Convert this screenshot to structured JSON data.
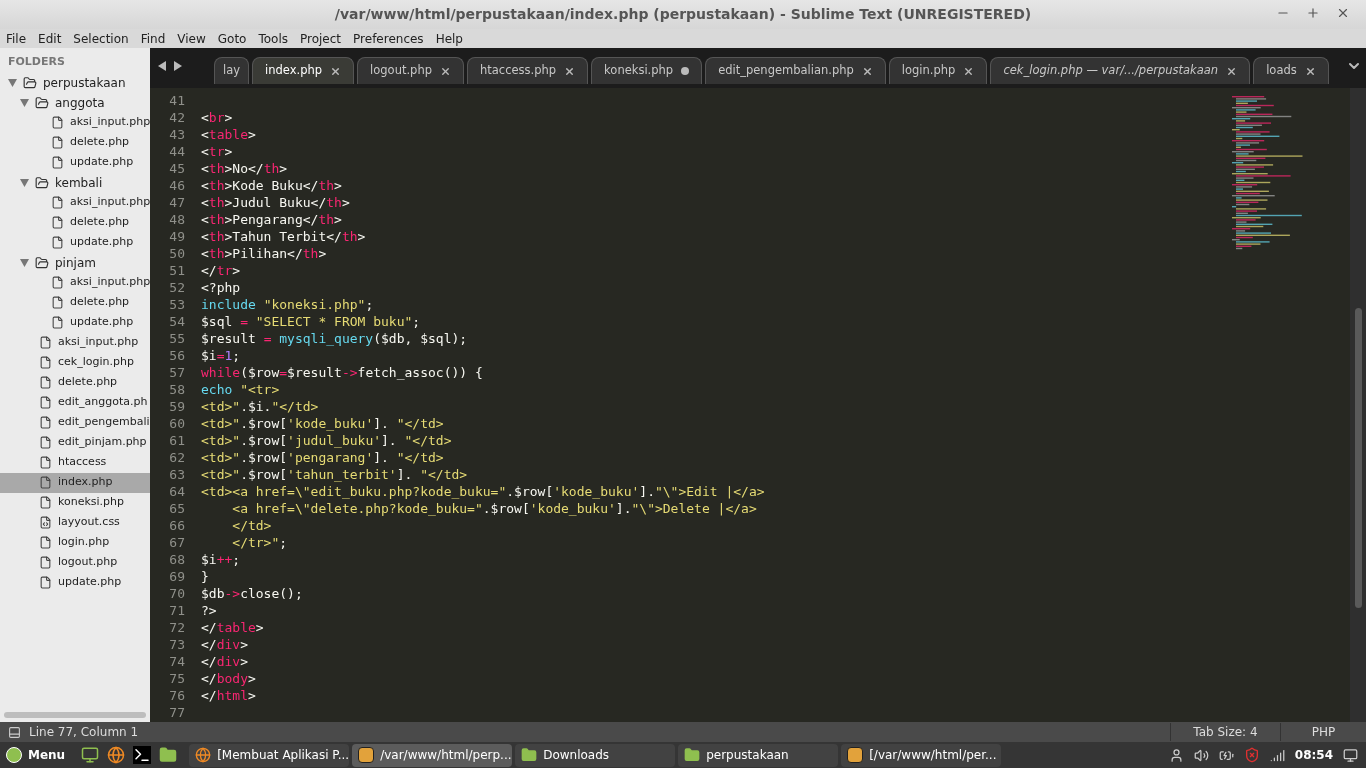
{
  "window": {
    "title": "/var/www/html/perpustakaan/index.php (perpustakaan) - Sublime Text (UNREGISTERED)"
  },
  "menu": [
    "File",
    "Edit",
    "Selection",
    "Find",
    "View",
    "Goto",
    "Tools",
    "Project",
    "Preferences",
    "Help"
  ],
  "sidebar": {
    "heading": "FOLDERS",
    "items": [
      {
        "kind": "folder",
        "label": "perpustakaan",
        "expanded": true,
        "selected": false,
        "children": [
          {
            "kind": "folder",
            "label": "anggota",
            "expanded": true,
            "selected": false,
            "children": [
              {
                "kind": "file",
                "label": "aksi_input.php",
                "selected": false
              },
              {
                "kind": "file",
                "label": "delete.php",
                "selected": false
              },
              {
                "kind": "file",
                "label": "update.php",
                "selected": false
              }
            ]
          },
          {
            "kind": "folder",
            "label": "kembali",
            "expanded": true,
            "selected": false,
            "children": [
              {
                "kind": "file",
                "label": "aksi_input.php",
                "selected": false
              },
              {
                "kind": "file",
                "label": "delete.php",
                "selected": false
              },
              {
                "kind": "file",
                "label": "update.php",
                "selected": false
              }
            ]
          },
          {
            "kind": "folder",
            "label": "pinjam",
            "expanded": true,
            "selected": false,
            "children": [
              {
                "kind": "file",
                "label": "aksi_input.php",
                "selected": false
              },
              {
                "kind": "file",
                "label": "delete.php",
                "selected": false
              },
              {
                "kind": "file",
                "label": "update.php",
                "selected": false
              }
            ]
          },
          {
            "kind": "file",
            "label": "aksi_input.php",
            "selected": false
          },
          {
            "kind": "file",
            "label": "cek_login.php",
            "selected": false
          },
          {
            "kind": "file",
            "label": "delete.php",
            "selected": false
          },
          {
            "kind": "file",
            "label": "edit_anggota.ph",
            "selected": false
          },
          {
            "kind": "file",
            "label": "edit_pengembali",
            "selected": false
          },
          {
            "kind": "file",
            "label": "edit_pinjam.php",
            "selected": false
          },
          {
            "kind": "file",
            "label": "htaccess",
            "selected": false
          },
          {
            "kind": "file",
            "label": "index.php",
            "selected": true
          },
          {
            "kind": "file",
            "label": "koneksi.php",
            "selected": false
          },
          {
            "kind": "style",
            "label": "layyout.css",
            "selected": false
          },
          {
            "kind": "file",
            "label": "login.php",
            "selected": false
          },
          {
            "kind": "file",
            "label": "logout.php",
            "selected": false
          },
          {
            "kind": "file",
            "label": "update.php",
            "selected": false
          }
        ]
      }
    ]
  },
  "tabs": [
    {
      "label": "lay",
      "selected": false,
      "dirty": false,
      "transient": false,
      "cut": true
    },
    {
      "label": "index.php",
      "selected": true,
      "dirty": false,
      "transient": false,
      "cut": false
    },
    {
      "label": "logout.php",
      "selected": false,
      "dirty": false,
      "transient": false,
      "cut": false
    },
    {
      "label": "htaccess.php",
      "selected": false,
      "dirty": false,
      "transient": false,
      "cut": false
    },
    {
      "label": "koneksi.php",
      "selected": false,
      "dirty": true,
      "transient": false,
      "cut": false
    },
    {
      "label": "edit_pengembalian.php",
      "selected": false,
      "dirty": false,
      "transient": false,
      "cut": false
    },
    {
      "label": "login.php",
      "selected": false,
      "dirty": false,
      "transient": false,
      "cut": false
    },
    {
      "label": "cek_login.php — var/.../perpustakaan",
      "selected": false,
      "dirty": false,
      "transient": true,
      "cut": false
    },
    {
      "label": "loads",
      "selected": false,
      "dirty": false,
      "transient": false,
      "cut": false
    }
  ],
  "code": [
    {
      "n": "41"
    },
    {
      "n": "42",
      "tokens": [
        {
          "kind": "plain",
          "text": "<"
        },
        {
          "kind": "tag",
          "text": "br"
        },
        {
          "kind": "plain",
          "text": ">"
        }
      ]
    },
    {
      "n": "43",
      "tokens": [
        {
          "kind": "plain",
          "text": "<"
        },
        {
          "kind": "tag",
          "text": "table"
        },
        {
          "kind": "plain",
          "text": ">"
        }
      ]
    },
    {
      "n": "44",
      "tokens": [
        {
          "kind": "plain",
          "text": "<"
        },
        {
          "kind": "tag",
          "text": "tr"
        },
        {
          "kind": "plain",
          "text": ">"
        }
      ]
    },
    {
      "n": "45",
      "tokens": [
        {
          "kind": "plain",
          "text": "<"
        },
        {
          "kind": "tag",
          "text": "th"
        },
        {
          "kind": "plain",
          "text": ">No</"
        },
        {
          "kind": "tag",
          "text": "th"
        },
        {
          "kind": "plain",
          "text": ">"
        }
      ]
    },
    {
      "n": "46",
      "tokens": [
        {
          "kind": "plain",
          "text": "<"
        },
        {
          "kind": "tag",
          "text": "th"
        },
        {
          "kind": "plain",
          "text": ">Kode Buku</"
        },
        {
          "kind": "tag",
          "text": "th"
        },
        {
          "kind": "plain",
          "text": ">"
        }
      ]
    },
    {
      "n": "47",
      "tokens": [
        {
          "kind": "plain",
          "text": "<"
        },
        {
          "kind": "tag",
          "text": "th"
        },
        {
          "kind": "plain",
          "text": ">Judul Buku</"
        },
        {
          "kind": "tag",
          "text": "th"
        },
        {
          "kind": "plain",
          "text": ">"
        }
      ]
    },
    {
      "n": "48",
      "tokens": [
        {
          "kind": "plain",
          "text": "<"
        },
        {
          "kind": "tag",
          "text": "th"
        },
        {
          "kind": "plain",
          "text": ">Pengarang</"
        },
        {
          "kind": "tag",
          "text": "th"
        },
        {
          "kind": "plain",
          "text": ">"
        }
      ]
    },
    {
      "n": "49",
      "tokens": [
        {
          "kind": "plain",
          "text": "<"
        },
        {
          "kind": "tag",
          "text": "th"
        },
        {
          "kind": "plain",
          "text": ">Tahun Terbit</"
        },
        {
          "kind": "tag",
          "text": "th"
        },
        {
          "kind": "plain",
          "text": ">"
        }
      ]
    },
    {
      "n": "50",
      "tokens": [
        {
          "kind": "plain",
          "text": "<"
        },
        {
          "kind": "tag",
          "text": "th"
        },
        {
          "kind": "plain",
          "text": ">Pilihan</"
        },
        {
          "kind": "tag",
          "text": "th"
        },
        {
          "kind": "plain",
          "text": ">"
        }
      ]
    },
    {
      "n": "51",
      "tokens": [
        {
          "kind": "plain",
          "text": "</"
        },
        {
          "kind": "tag",
          "text": "tr"
        },
        {
          "kind": "plain",
          "text": ">"
        }
      ]
    },
    {
      "n": "52",
      "tokens": [
        {
          "kind": "plain",
          "text": "<?php"
        }
      ]
    },
    {
      "n": "53",
      "tokens": [
        {
          "kind": "func",
          "text": "include "
        },
        {
          "kind": "string",
          "text": "\"koneksi.php\""
        },
        {
          "kind": "plain",
          "text": ";"
        }
      ]
    },
    {
      "n": "54",
      "tokens": [
        {
          "kind": "plain",
          "text": "$sql "
        },
        {
          "kind": "tag",
          "text": "= "
        },
        {
          "kind": "string",
          "text": "\"SELECT * FROM buku\""
        },
        {
          "kind": "plain",
          "text": ";"
        }
      ]
    },
    {
      "n": "55",
      "tokens": [
        {
          "kind": "plain",
          "text": "$result "
        },
        {
          "kind": "tag",
          "text": "= "
        },
        {
          "kind": "func",
          "text": "mysqli_query"
        },
        {
          "kind": "plain",
          "text": "($db, $sql);"
        }
      ]
    },
    {
      "n": "56",
      "tokens": [
        {
          "kind": "plain",
          "text": "$i"
        },
        {
          "kind": "tag",
          "text": "="
        },
        {
          "kind": "number",
          "text": "1"
        },
        {
          "kind": "plain",
          "text": ";"
        }
      ]
    },
    {
      "n": "57",
      "tokens": [
        {
          "kind": "tag",
          "text": "while"
        },
        {
          "kind": "plain",
          "text": "($row"
        },
        {
          "kind": "tag",
          "text": "="
        },
        {
          "kind": "plain",
          "text": "$result"
        },
        {
          "kind": "tag",
          "text": "->"
        },
        {
          "kind": "plain",
          "text": "fetch_assoc()) {"
        }
      ]
    },
    {
      "n": "58",
      "tokens": [
        {
          "kind": "func",
          "text": "echo "
        },
        {
          "kind": "string",
          "text": "\"<tr>"
        }
      ]
    },
    {
      "n": "59",
      "tokens": [
        {
          "kind": "string",
          "text": "<td>\""
        },
        {
          "kind": "plain",
          "text": ".$i."
        },
        {
          "kind": "string",
          "text": "\"</td>"
        }
      ]
    },
    {
      "n": "60",
      "tokens": [
        {
          "kind": "string",
          "text": "<td>\""
        },
        {
          "kind": "plain",
          "text": ".$row["
        },
        {
          "kind": "string",
          "text": "'kode_buku'"
        },
        {
          "kind": "plain",
          "text": "]. "
        },
        {
          "kind": "string",
          "text": "\"</td>"
        }
      ]
    },
    {
      "n": "61",
      "tokens": [
        {
          "kind": "string",
          "text": "<td>\""
        },
        {
          "kind": "plain",
          "text": ".$row["
        },
        {
          "kind": "string",
          "text": "'judul_buku'"
        },
        {
          "kind": "plain",
          "text": "]. "
        },
        {
          "kind": "string",
          "text": "\"</td>"
        }
      ]
    },
    {
      "n": "62",
      "tokens": [
        {
          "kind": "string",
          "text": "<td>\""
        },
        {
          "kind": "plain",
          "text": ".$row["
        },
        {
          "kind": "string",
          "text": "'pengarang'"
        },
        {
          "kind": "plain",
          "text": "]. "
        },
        {
          "kind": "string",
          "text": "\"</td>"
        }
      ]
    },
    {
      "n": "63",
      "tokens": [
        {
          "kind": "string",
          "text": "<td>\""
        },
        {
          "kind": "plain",
          "text": ".$row["
        },
        {
          "kind": "string",
          "text": "'tahun_terbit'"
        },
        {
          "kind": "plain",
          "text": "]. "
        },
        {
          "kind": "string",
          "text": "\"</td>"
        }
      ]
    },
    {
      "n": "64",
      "tokens": [
        {
          "kind": "string",
          "text": "<td><a href=\\\"edit_buku.php?kode_buku=\""
        },
        {
          "kind": "plain",
          "text": ".$row["
        },
        {
          "kind": "string",
          "text": "'kode_buku'"
        },
        {
          "kind": "plain",
          "text": "]."
        },
        {
          "kind": "string",
          "text": "\"\\\">Edit |</a>"
        }
      ]
    },
    {
      "n": "65",
      "tokens": [
        {
          "kind": "string",
          "text": "    <a href=\\\"delete.php?kode_buku=\""
        },
        {
          "kind": "plain",
          "text": ".$row["
        },
        {
          "kind": "string",
          "text": "'kode_buku'"
        },
        {
          "kind": "plain",
          "text": "]."
        },
        {
          "kind": "string",
          "text": "\"\\\">Delete |</a>"
        }
      ]
    },
    {
      "n": "66",
      "tokens": [
        {
          "kind": "string",
          "text": "    </td>"
        }
      ]
    },
    {
      "n": "67",
      "tokens": [
        {
          "kind": "string",
          "text": "    </tr>\""
        },
        {
          "kind": "plain",
          "text": ";"
        }
      ]
    },
    {
      "n": "68",
      "tokens": [
        {
          "kind": "plain",
          "text": "$i"
        },
        {
          "kind": "tag",
          "text": "++"
        },
        {
          "kind": "plain",
          "text": ";"
        }
      ]
    },
    {
      "n": "69",
      "tokens": [
        {
          "kind": "plain",
          "text": "}"
        }
      ]
    },
    {
      "n": "70",
      "tokens": [
        {
          "kind": "plain",
          "text": "$db"
        },
        {
          "kind": "tag",
          "text": "->"
        },
        {
          "kind": "plain",
          "text": "close();"
        }
      ]
    },
    {
      "n": "71",
      "tokens": [
        {
          "kind": "plain",
          "text": "?>"
        }
      ]
    },
    {
      "n": "72",
      "tokens": [
        {
          "kind": "plain",
          "text": "</"
        },
        {
          "kind": "tag",
          "text": "table"
        },
        {
          "kind": "plain",
          "text": ">"
        }
      ]
    },
    {
      "n": "73",
      "tokens": [
        {
          "kind": "plain",
          "text": "</"
        },
        {
          "kind": "tag",
          "text": "div"
        },
        {
          "kind": "plain",
          "text": ">"
        }
      ]
    },
    {
      "n": "74",
      "tokens": [
        {
          "kind": "plain",
          "text": "</"
        },
        {
          "kind": "tag",
          "text": "div"
        },
        {
          "kind": "plain",
          "text": ">"
        }
      ]
    },
    {
      "n": "75",
      "tokens": [
        {
          "kind": "plain",
          "text": "</"
        },
        {
          "kind": "tag",
          "text": "body"
        },
        {
          "kind": "plain",
          "text": ">"
        }
      ]
    },
    {
      "n": "76",
      "tokens": [
        {
          "kind": "plain",
          "text": "</"
        },
        {
          "kind": "tag",
          "text": "html"
        },
        {
          "kind": "plain",
          "text": ">"
        }
      ]
    },
    {
      "n": "77"
    }
  ],
  "status_bar": {
    "position": "Line 77, Column 1",
    "tab_size": "Tab Size: 4",
    "syntax": "PHP"
  },
  "taskbar": {
    "menu": "Menu",
    "launchers": [
      {
        "kind": "desktop"
      },
      {
        "kind": "browser"
      },
      {
        "kind": "terminal"
      },
      {
        "kind": "folder"
      }
    ],
    "windows": [
      {
        "kind": "browser",
        "label": "[Membuat Aplikasi P...",
        "selected": false
      },
      {
        "kind": "editor",
        "label": "/var/www/html/perp...",
        "selected": true
      },
      {
        "kind": "folder",
        "label": "Downloads",
        "selected": false
      },
      {
        "kind": "folder",
        "label": "perpustakaan",
        "selected": false
      },
      {
        "kind": "editor",
        "label": "[/var/www/html/per...",
        "selected": false
      }
    ],
    "clock": "08:54"
  }
}
